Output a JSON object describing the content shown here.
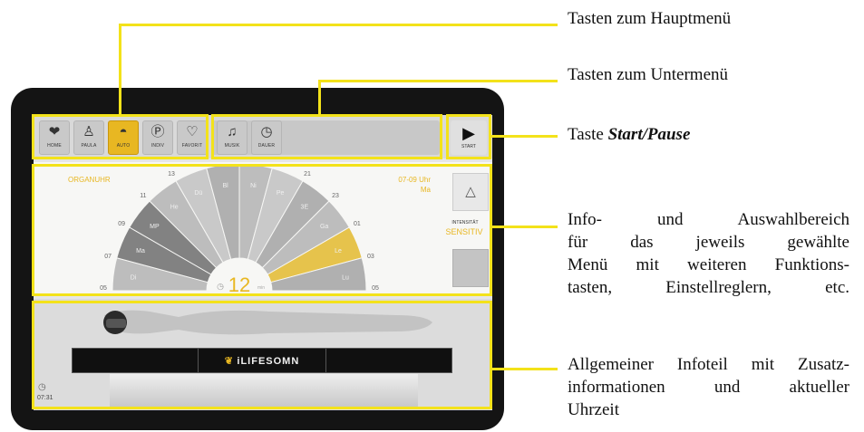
{
  "main_menu": {
    "buttons": [
      {
        "label": "HOME",
        "icon": "heart-badge-icon"
      },
      {
        "label": "PAULA",
        "icon": "person-icon"
      },
      {
        "label": "AUTO",
        "icon": "gauge-icon",
        "active": true
      },
      {
        "label": "INDIV",
        "icon": "p-card-icon"
      },
      {
        "label": "FAVORIT",
        "icon": "heart-outline-icon"
      }
    ]
  },
  "sub_menu": {
    "buttons": [
      {
        "label": "MUSIK",
        "icon": "music-note-icon"
      },
      {
        "label": "DAUER",
        "icon": "timer-icon"
      }
    ]
  },
  "start_button": {
    "label": "START",
    "icon": "play-icon"
  },
  "organ_clock": {
    "title": "ORGANUHR",
    "time_range": "07-09 Uhr",
    "organ_short": "Ma",
    "hour_labels": [
      "05",
      "07",
      "09",
      "11",
      "13",
      "15",
      "17",
      "19",
      "21",
      "23",
      "01",
      "03",
      "05"
    ],
    "segments": [
      "Di",
      "Ma",
      "MP",
      "He",
      "Dü",
      "Bl",
      "Ni",
      "Pe",
      "3E",
      "Ga",
      "Le",
      "Lu"
    ],
    "center_value": "12",
    "center_unit": "min"
  },
  "intensity": {
    "label": "INTENSITÄT",
    "value": "SENSITIV",
    "up_icon": "triangle-up-icon"
  },
  "info_bar": {
    "time": "07:31",
    "brand": "iLIFESOMN"
  },
  "callouts": {
    "main_menu": "Tasten zum Hauptmenü",
    "sub_menu": "Tasten zum Untermenü",
    "start_prefix": "Taste ",
    "start_emph": "Start/Pause",
    "info_lines": [
      "Info- und Auswahlbereich",
      "für das jeweils gewählte",
      "Menü mit weiteren Funktions-",
      "tasten, Einstellreglern, etc."
    ],
    "general_lines": [
      "Allgemeiner Infoteil mit Zusatz-",
      "informationen und aktueller",
      "Uhrzeit"
    ]
  },
  "colors": {
    "highlight": "#f3e21a",
    "accent": "#e8b722",
    "tablet": "#141414"
  }
}
